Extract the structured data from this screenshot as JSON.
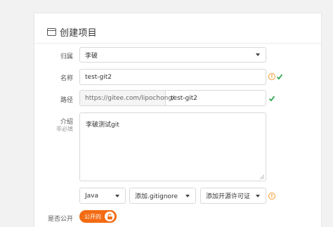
{
  "form": {
    "title": "创建项目",
    "owner": {
      "label": "归属",
      "value": "李破"
    },
    "name": {
      "label": "名称",
      "value": "test-git2"
    },
    "path": {
      "label": "路径",
      "prefix": "https://gitee.com/lipochong/",
      "value": "test-git2"
    },
    "description": {
      "label": "介绍",
      "sublabel": "非必填",
      "value": "李破测试git"
    },
    "language": {
      "value": "Java"
    },
    "gitignore": {
      "value": "添加.gitignore"
    },
    "license": {
      "value": "添加开源许可证"
    },
    "visibility": {
      "label": "是否公开",
      "toggle_text": "公开的"
    }
  },
  "colors": {
    "accent": "#f36b13",
    "success": "#2fa84f",
    "warning": "#f39a2b"
  }
}
